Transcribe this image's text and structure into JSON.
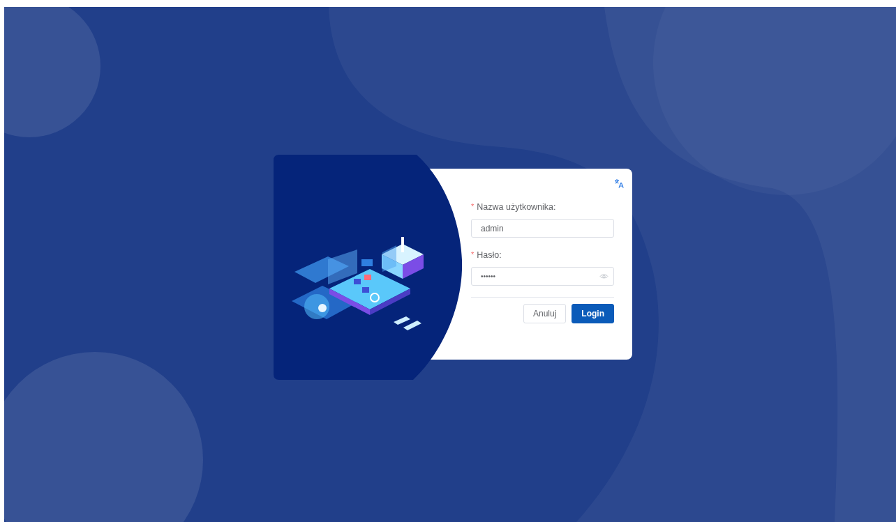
{
  "fields": [
    {
      "kind": "text",
      "required_mark": "*",
      "label": "Nazwa użytkownika",
      "separator": ":",
      "value": "admin"
    },
    {
      "kind": "password",
      "required_mark": "*",
      "label": "Hasło",
      "separator": ":",
      "value": "••••••"
    }
  ],
  "buttons": [
    {
      "label": "Anuluj",
      "primary": false
    },
    {
      "label": "Login",
      "primary": true
    }
  ]
}
